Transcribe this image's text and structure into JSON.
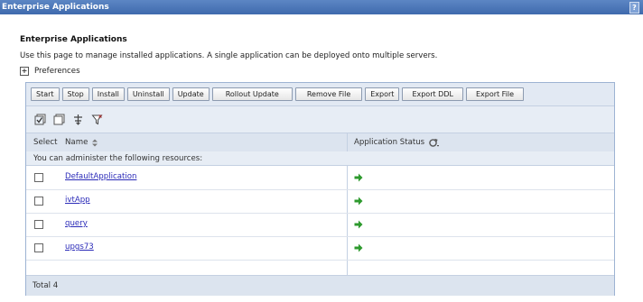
{
  "window": {
    "title": "Enterprise Applications",
    "help_label": "?"
  },
  "page": {
    "heading": "Enterprise Applications",
    "description": "Use this page to manage installed applications. A single application can be deployed onto multiple servers.",
    "preferences_label": "Preferences",
    "preferences_expander": "+"
  },
  "toolbar": {
    "buttons": [
      "Start",
      "Stop",
      "Install",
      "Uninstall",
      "Update",
      "Rollout Update",
      "Remove File",
      "Export",
      "Export DDL",
      "Export File"
    ]
  },
  "icon_toolbar": {
    "icons": [
      "select-all-icon",
      "deselect-all-icon",
      "show-filter-icon",
      "clear-filter-icon"
    ]
  },
  "table": {
    "columns": {
      "select": "Select",
      "name": "Name",
      "status": "Application Status"
    },
    "info_text": "You can administer the following resources:",
    "rows": [
      {
        "name": "DefaultApplication",
        "status": "started"
      },
      {
        "name": "ivtApp",
        "status": "started"
      },
      {
        "name": "query",
        "status": "started"
      },
      {
        "name": "upgs73",
        "status": "started"
      }
    ],
    "total_label": "Total 4"
  },
  "colors": {
    "titlebar": "#4a76b8",
    "status_started": "#2e9a2e",
    "link": "#2a2ab8"
  }
}
